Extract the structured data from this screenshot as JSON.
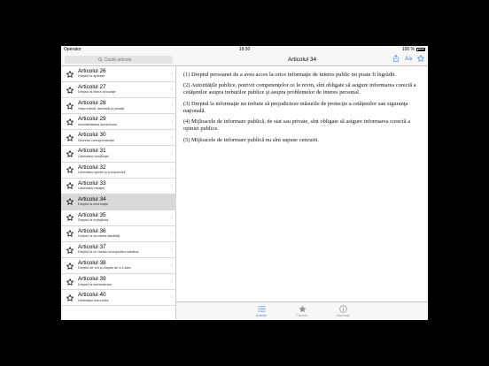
{
  "status": {
    "carrier": "Operator",
    "time": "19:30",
    "battery": "100 %"
  },
  "search": {
    "placeholder": "Caută articole"
  },
  "list": [
    {
      "title": "Articolul 26",
      "sub": "Dreptul la apărare"
    },
    {
      "title": "Articolul 27",
      "sub": "Dreptul la libera circulaţie"
    },
    {
      "title": "Articolul 28",
      "sub": "Viaţa intimă, familială şi privată"
    },
    {
      "title": "Articolul 29",
      "sub": "Inviolabilitatea domiciliului"
    },
    {
      "title": "Articolul 30",
      "sub": "Secretul corespondenţei"
    },
    {
      "title": "Articolul 31",
      "sub": "Libertatea conştiinţei"
    },
    {
      "title": "Articolul 32",
      "sub": "Libertatea opiniei şi a exprimării"
    },
    {
      "title": "Articolul 33",
      "sub": "Libertatea creaţiei"
    },
    {
      "title": "Articolul 34",
      "sub": "Dreptul la informaţie"
    },
    {
      "title": "Articolul 35",
      "sub": "Dreptul la învăţătură"
    },
    {
      "title": "Articolul 36",
      "sub": "Dreptul la ocrotirea sănătăţii"
    },
    {
      "title": "Articolul 37",
      "sub": "Dreptul la un mediu înconjurător sănătos"
    },
    {
      "title": "Articolul 38",
      "sub": "Dreptul de vot şi dreptul de a fi ales"
    },
    {
      "title": "Articolul 39",
      "sub": "Dreptul la administrare"
    },
    {
      "title": "Articolul 40",
      "sub": "Libertatea întrunirilor"
    }
  ],
  "selected_index": 8,
  "nav": {
    "title": "Articolul 34",
    "font_label": "Aa"
  },
  "content": {
    "p1": "(1) Dreptul persoanei de a avea acces la orice informaţie de interes public nu poate fi îngrădit.",
    "p2": "(2) Autorităţile publice, potrivit competenţelor ce le revin, sînt obligate să asigure informarea corectă a cetăţenilor asupra treburilor publice şi asupra problemelor de interes personal.",
    "p3": "(3) Dreptul la informaţie nu trebuie să prejudicieze măsurile de protecţie a cetăţenilor sau siguranţa naţională.",
    "p4": "(4) Mijloacele de informare publică, de stat sau private, sînt obligate să asigure informarea corectă a opiniei publice.",
    "p5": "(5) Mijloacele de informare publică nu sînt supuse cenzurii."
  },
  "tabs": [
    {
      "label": "Articole",
      "icon": "list-icon",
      "active": true
    },
    {
      "label": "Favorite",
      "icon": "star-icon",
      "active": false
    },
    {
      "label": "Informaţii",
      "icon": "info-icon",
      "active": false
    }
  ],
  "colors": {
    "accent": "#2d86f5",
    "selected_row": "#d9d9d9",
    "bar_bg": "#f7f7f7"
  }
}
